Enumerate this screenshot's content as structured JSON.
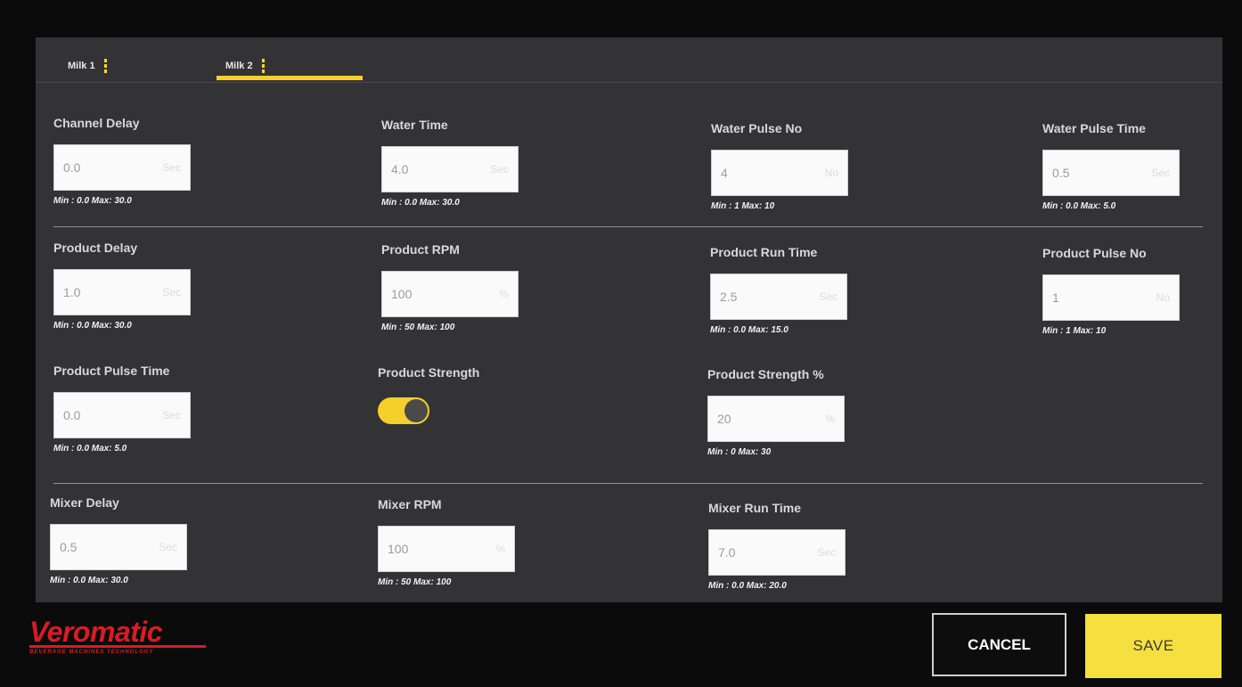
{
  "tabs": [
    {
      "label": "Milk 1"
    },
    {
      "label": "Milk 2"
    }
  ],
  "fields": {
    "channel_delay": {
      "label": "Channel Delay",
      "value": "0.0",
      "unit": "Sec",
      "range": "Min : 0.0 Max: 30.0"
    },
    "water_time": {
      "label": "Water Time",
      "value": "4.0",
      "unit": "Sec",
      "range": "Min : 0.0 Max: 30.0"
    },
    "water_pulse_no": {
      "label": "Water Pulse No",
      "value": "4",
      "unit": "No",
      "range": "Min : 1 Max: 10"
    },
    "water_pulse_time": {
      "label": "Water Pulse Time",
      "value": "0.5",
      "unit": "Sec",
      "range": "Min : 0.0 Max: 5.0"
    },
    "product_delay": {
      "label": "Product Delay",
      "value": "1.0",
      "unit": "Sec",
      "range": "Min : 0.0 Max: 30.0"
    },
    "product_rpm": {
      "label": "Product RPM",
      "value": "100",
      "unit": "%",
      "range": "Min : 50 Max: 100"
    },
    "product_run_time": {
      "label": "Product Run Time",
      "value": "2.5",
      "unit": "Sec",
      "range": "Min : 0.0 Max: 15.0"
    },
    "product_pulse_no": {
      "label": "Product Pulse No",
      "value": "1",
      "unit": "No",
      "range": "Min : 1 Max: 10"
    },
    "product_pulse_time": {
      "label": "Product Pulse Time",
      "value": "0.0",
      "unit": "Sec",
      "range": "Min : 0.0 Max: 5.0"
    },
    "product_strength": {
      "label": "Product Strength",
      "enabled": true
    },
    "product_strength_pct": {
      "label": "Product Strength %",
      "value": "20",
      "unit": "%",
      "range": "Min : 0 Max: 30"
    },
    "mixer_delay": {
      "label": "Mixer Delay",
      "value": "0.5",
      "unit": "Sec",
      "range": "Min : 0.0 Max: 30.0"
    },
    "mixer_rpm": {
      "label": "Mixer RPM",
      "value": "100",
      "unit": "%",
      "range": "Min : 50 Max: 100"
    },
    "mixer_run_time": {
      "label": "Mixer Run Time",
      "value": "7.0",
      "unit": "Sec",
      "range": "Min : 0.0 Max: 20.0"
    }
  },
  "footer": {
    "logo_text": "Veromatic",
    "logo_subtext": "BEVERAGE MACHINES TECHNOLOGY",
    "cancel_label": "CANCEL",
    "save_label": "SAVE"
  },
  "colors": {
    "accent": "#f5d02a",
    "panel": "#333335",
    "brand": "#d81c24"
  }
}
